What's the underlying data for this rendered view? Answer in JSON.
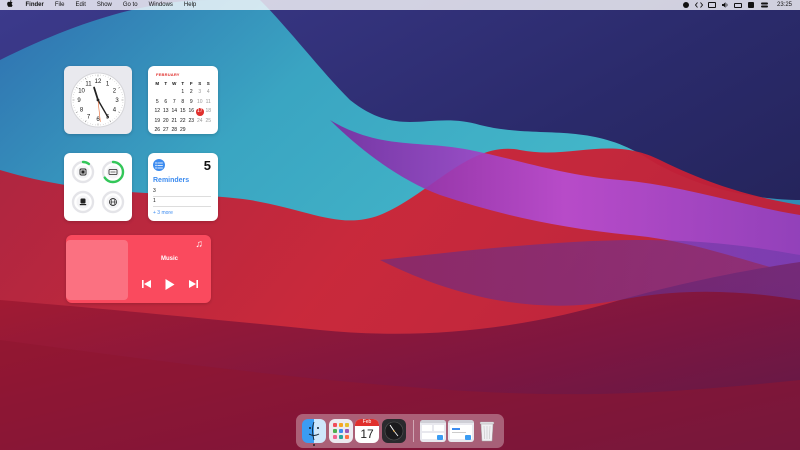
{
  "menubar": {
    "apple_icon": "apple-logo-icon",
    "items": [
      "Finder",
      "File",
      "Edit",
      "Show",
      "Go to",
      "Windows",
      "Help"
    ],
    "status_icons": [
      "record-icon",
      "code-icon",
      "display-icon",
      "volume-icon",
      "battery-icon",
      "wifi-icon",
      "control-center-icon"
    ],
    "clock": "23:25"
  },
  "clock_widget": {
    "numbers": [
      "12",
      "1",
      "2",
      "3",
      "4",
      "5",
      "6",
      "7",
      "8",
      "9",
      "10",
      "11"
    ]
  },
  "calendar_widget": {
    "month": "FEBRUARY",
    "weekdays": [
      "M",
      "T",
      "W",
      "T",
      "F",
      "S",
      "S"
    ],
    "days": [
      "1",
      "2",
      "3",
      "4",
      "5",
      "6",
      "7",
      "8",
      "9",
      "10",
      "11",
      "12",
      "13",
      "14",
      "15",
      "16",
      "17",
      "18",
      "19",
      "20",
      "21",
      "22",
      "23",
      "24",
      "25",
      "26",
      "27",
      "28",
      "29"
    ],
    "first_weekday_index": 3,
    "today": "17",
    "accent": "#e0302d"
  },
  "battery_widget": {
    "devices": [
      {
        "icon": "mac-icon",
        "level": 0.1,
        "color": "#33c759"
      },
      {
        "icon": "keyboard-icon",
        "level": 0.65,
        "color": "#33c759"
      },
      {
        "icon": "mouse-icon",
        "level": 0,
        "color": "#33c759"
      },
      {
        "icon": "globe-icon",
        "level": 0,
        "color": "#33c759"
      }
    ]
  },
  "reminders_widget": {
    "count": "5",
    "title": "Reminders",
    "items": [
      "3",
      "1"
    ],
    "more": "+ 3 more",
    "accent": "#3d8cf0"
  },
  "music_widget": {
    "title": "Music",
    "icons": [
      "music-note-icon",
      "previous-icon",
      "play-icon",
      "next-icon"
    ],
    "color": "#fa4a5e"
  },
  "dock": {
    "calendar_month": "Feb",
    "calendar_day": "17",
    "apps": [
      "finder-icon",
      "launchpad-icon",
      "calendar-icon",
      "clock-app-icon",
      "window-thumbnail-1",
      "window-thumbnail-2",
      "trash-icon"
    ]
  }
}
